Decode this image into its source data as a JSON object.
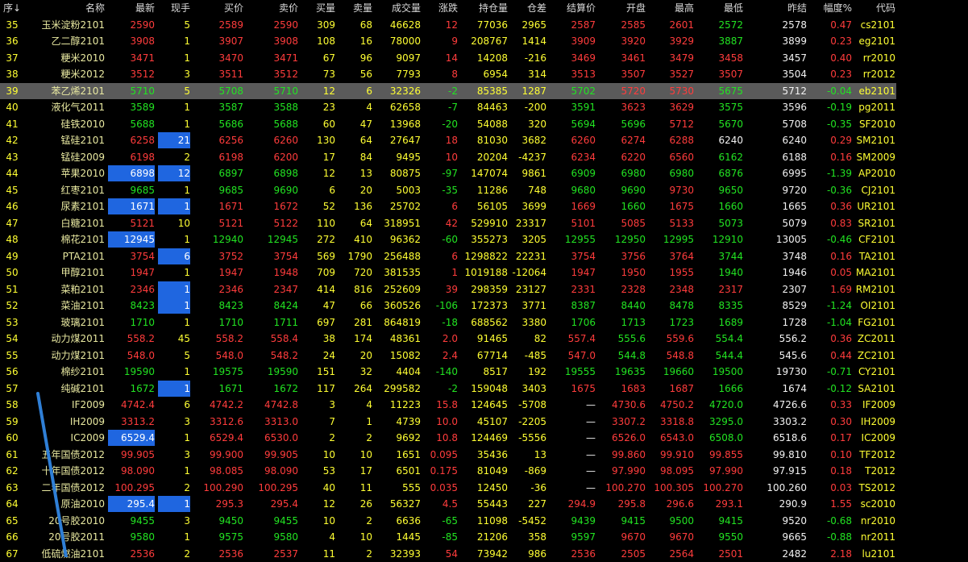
{
  "colors": {
    "up": "#ff3c3c",
    "down": "#22e322",
    "flat": "#f2f2f2",
    "label": "#ffff33",
    "highlight": "#1f66e0",
    "selected_row": "#5a5a5a"
  },
  "headers": [
    "序↓",
    "名称",
    "最新",
    "现手",
    "买价",
    "卖价",
    "买量",
    "卖量",
    "成交量",
    "涨跌",
    "持仓量",
    "仓差",
    "结算价",
    "开盘",
    "最高",
    "最低",
    "昨结",
    "幅度%",
    "代码"
  ],
  "rows": [
    [
      "35",
      "玉米淀粉2101",
      "2590",
      "5",
      "2589",
      "2590",
      "309",
      "68",
      "46628",
      "12",
      "77036",
      "2965",
      "2587",
      "2585",
      "2601",
      "2572",
      "2578",
      "0.47",
      "cs2101"
    ],
    [
      "36",
      "乙二醇2101",
      "3908",
      "1",
      "3907",
      "3908",
      "108",
      "16",
      "78000",
      "9",
      "208767",
      "1414",
      "3909",
      "3920",
      "3929",
      "3887",
      "3899",
      "0.23",
      "eg2101"
    ],
    [
      "37",
      "粳米2010",
      "3471",
      "1",
      "3470",
      "3471",
      "67",
      "96",
      "9097",
      "14",
      "14208",
      "-216",
      "3469",
      "3461",
      "3479",
      "3458",
      "3457",
      "0.40",
      "rr2010"
    ],
    [
      "38",
      "粳米2012",
      "3512",
      "3",
      "3511",
      "3512",
      "73",
      "56",
      "7793",
      "8",
      "6954",
      "314",
      "3513",
      "3507",
      "3527",
      "3507",
      "3504",
      "0.23",
      "rr2012"
    ],
    [
      "39",
      "苯乙烯2101",
      "5710",
      "5",
      "5708",
      "5710",
      "12",
      "6",
      "32326",
      "-2",
      "85385",
      "1287",
      "5702",
      "5720",
      "5730",
      "5675",
      "5712",
      "-0.04",
      "eb2101"
    ],
    [
      "40",
      "液化气2011",
      "3589",
      "1",
      "3587",
      "3588",
      "23",
      "4",
      "62658",
      "-7",
      "84463",
      "-200",
      "3591",
      "3623",
      "3629",
      "3575",
      "3596",
      "-0.19",
      "pg2011"
    ],
    [
      "41",
      "硅铁2010",
      "5688",
      "1",
      "5686",
      "5688",
      "60",
      "47",
      "13968",
      "-20",
      "54088",
      "320",
      "5694",
      "5696",
      "5712",
      "5670",
      "5708",
      "-0.35",
      "SF2010"
    ],
    [
      "42",
      "锰硅2101",
      "6258",
      "21",
      "6256",
      "6260",
      "130",
      "64",
      "27647",
      "18",
      "81030",
      "3682",
      "6260",
      "6274",
      "6288",
      "6240",
      "6240",
      "0.29",
      "SM2101"
    ],
    [
      "43",
      "锰硅2009",
      "6198",
      "2",
      "6198",
      "6200",
      "17",
      "84",
      "9495",
      "10",
      "20204",
      "-4237",
      "6234",
      "6220",
      "6560",
      "6162",
      "6188",
      "0.16",
      "SM2009"
    ],
    [
      "44",
      "苹果2010",
      "6898",
      "12",
      "6897",
      "6898",
      "12",
      "13",
      "80875",
      "-97",
      "147074",
      "9861",
      "6909",
      "6980",
      "6980",
      "6876",
      "6995",
      "-1.39",
      "AP2010"
    ],
    [
      "45",
      "红枣2101",
      "9685",
      "1",
      "9685",
      "9690",
      "6",
      "20",
      "5003",
      "-35",
      "11286",
      "748",
      "9680",
      "9690",
      "9730",
      "9650",
      "9720",
      "-0.36",
      "CJ2101"
    ],
    [
      "46",
      "尿素2101",
      "1671",
      "1",
      "1671",
      "1672",
      "52",
      "136",
      "25702",
      "6",
      "56105",
      "3699",
      "1669",
      "1660",
      "1675",
      "1660",
      "1665",
      "0.36",
      "UR2101"
    ],
    [
      "47",
      "白糖2101",
      "5121",
      "10",
      "5121",
      "5122",
      "110",
      "64",
      "318951",
      "42",
      "529910",
      "23317",
      "5101",
      "5085",
      "5133",
      "5073",
      "5079",
      "0.83",
      "SR2101"
    ],
    [
      "48",
      "棉花2101",
      "12945",
      "1",
      "12940",
      "12945",
      "272",
      "410",
      "96362",
      "-60",
      "355273",
      "3205",
      "12955",
      "12950",
      "12995",
      "12910",
      "13005",
      "-0.46",
      "CF2101"
    ],
    [
      "49",
      "PTA2101",
      "3754",
      "6",
      "3752",
      "3754",
      "569",
      "1790",
      "256488",
      "6",
      "1298822",
      "22231",
      "3754",
      "3756",
      "3764",
      "3744",
      "3748",
      "0.16",
      "TA2101"
    ],
    [
      "50",
      "甲醇2101",
      "1947",
      "1",
      "1947",
      "1948",
      "709",
      "720",
      "381535",
      "1",
      "1019188",
      "-12064",
      "1947",
      "1950",
      "1955",
      "1940",
      "1946",
      "0.05",
      "MA2101"
    ],
    [
      "51",
      "菜粕2101",
      "2346",
      "1",
      "2346",
      "2347",
      "414",
      "816",
      "252609",
      "39",
      "298359",
      "23127",
      "2331",
      "2328",
      "2348",
      "2317",
      "2307",
      "1.69",
      "RM2101"
    ],
    [
      "52",
      "菜油2101",
      "8423",
      "1",
      "8423",
      "8424",
      "47",
      "66",
      "360526",
      "-106",
      "172373",
      "3771",
      "8387",
      "8440",
      "8478",
      "8335",
      "8529",
      "-1.24",
      "OI2101"
    ],
    [
      "53",
      "玻璃2101",
      "1710",
      "1",
      "1710",
      "1711",
      "697",
      "281",
      "864819",
      "-18",
      "688562",
      "3380",
      "1706",
      "1713",
      "1723",
      "1689",
      "1728",
      "-1.04",
      "FG2101"
    ],
    [
      "54",
      "动力煤2011",
      "558.2",
      "45",
      "558.2",
      "558.4",
      "38",
      "174",
      "48361",
      "2.0",
      "91465",
      "82",
      "557.4",
      "555.6",
      "559.6",
      "554.4",
      "556.2",
      "0.36",
      "ZC2011"
    ],
    [
      "55",
      "动力煤2101",
      "548.0",
      "5",
      "548.0",
      "548.2",
      "24",
      "20",
      "15082",
      "2.4",
      "67714",
      "-485",
      "547.0",
      "544.8",
      "548.8",
      "544.4",
      "545.6",
      "0.44",
      "ZC2101"
    ],
    [
      "56",
      "棉纱2101",
      "19590",
      "1",
      "19575",
      "19590",
      "151",
      "32",
      "4404",
      "-140",
      "8517",
      "192",
      "19555",
      "19635",
      "19660",
      "19500",
      "19730",
      "-0.71",
      "CY2101"
    ],
    [
      "57",
      "纯碱2101",
      "1672",
      "1",
      "1671",
      "1672",
      "117",
      "264",
      "299582",
      "-2",
      "159048",
      "3403",
      "1675",
      "1683",
      "1687",
      "1666",
      "1674",
      "-0.12",
      "SA2101"
    ],
    [
      "58",
      "IF2009",
      "4742.4",
      "6",
      "4742.2",
      "4742.8",
      "3",
      "4",
      "11223",
      "15.8",
      "124645",
      "-5708",
      "—",
      "4730.6",
      "4750.2",
      "4720.0",
      "4726.6",
      "0.33",
      "IF2009"
    ],
    [
      "59",
      "IH2009",
      "3313.2",
      "3",
      "3312.6",
      "3313.0",
      "7",
      "1",
      "4739",
      "10.0",
      "45107",
      "-2205",
      "—",
      "3307.2",
      "3318.8",
      "3295.0",
      "3303.2",
      "0.30",
      "IH2009"
    ],
    [
      "60",
      "IC2009",
      "6529.4",
      "1",
      "6529.4",
      "6530.0",
      "2",
      "2",
      "9692",
      "10.8",
      "124469",
      "-5556",
      "—",
      "6526.0",
      "6543.0",
      "6508.0",
      "6518.6",
      "0.17",
      "IC2009"
    ],
    [
      "61",
      "五年国债2012",
      "99.905",
      "3",
      "99.900",
      "99.905",
      "10",
      "10",
      "1651",
      "0.095",
      "35436",
      "13",
      "—",
      "99.860",
      "99.910",
      "99.855",
      "99.810",
      "0.10",
      "TF2012"
    ],
    [
      "62",
      "十年国债2012",
      "98.090",
      "1",
      "98.085",
      "98.090",
      "53",
      "17",
      "6501",
      "0.175",
      "81049",
      "-869",
      "—",
      "97.990",
      "98.095",
      "97.990",
      "97.915",
      "0.18",
      "T2012"
    ],
    [
      "63",
      "二年国债2012",
      "100.295",
      "2",
      "100.290",
      "100.295",
      "40",
      "11",
      "555",
      "0.035",
      "12450",
      "-36",
      "—",
      "100.270",
      "100.305",
      "100.270",
      "100.260",
      "0.03",
      "TS2012"
    ],
    [
      "64",
      "原油2010",
      "295.4",
      "1",
      "295.3",
      "295.4",
      "12",
      "26",
      "56327",
      "4.5",
      "55443",
      "227",
      "294.9",
      "295.8",
      "296.6",
      "293.1",
      "290.9",
      "1.55",
      "sc2010"
    ],
    [
      "65",
      "20号胶2010",
      "9455",
      "3",
      "9450",
      "9455",
      "10",
      "2",
      "6636",
      "-65",
      "11098",
      "-5452",
      "9439",
      "9415",
      "9500",
      "9415",
      "9520",
      "-0.68",
      "nr2010"
    ],
    [
      "66",
      "20号胶2011",
      "9580",
      "1",
      "9575",
      "9580",
      "4",
      "10",
      "1445",
      "-85",
      "21206",
      "358",
      "9597",
      "9670",
      "9670",
      "9550",
      "9665",
      "-0.88",
      "nr2011"
    ],
    [
      "67",
      "低硫燃油2101",
      "2536",
      "2",
      "2536",
      "2537",
      "11",
      "2",
      "32393",
      "54",
      "73942",
      "986",
      "2536",
      "2505",
      "2564",
      "2501",
      "2482",
      "2.18",
      "lu2101"
    ]
  ],
  "selected_row": 4,
  "highlighted_cells": [
    [
      7,
      3
    ],
    [
      9,
      2
    ],
    [
      9,
      3
    ],
    [
      11,
      2
    ],
    [
      11,
      3
    ],
    [
      13,
      2
    ],
    [
      14,
      3
    ],
    [
      16,
      3
    ],
    [
      17,
      3
    ],
    [
      22,
      3
    ],
    [
      25,
      2
    ],
    [
      29,
      2
    ],
    [
      29,
      3
    ]
  ]
}
